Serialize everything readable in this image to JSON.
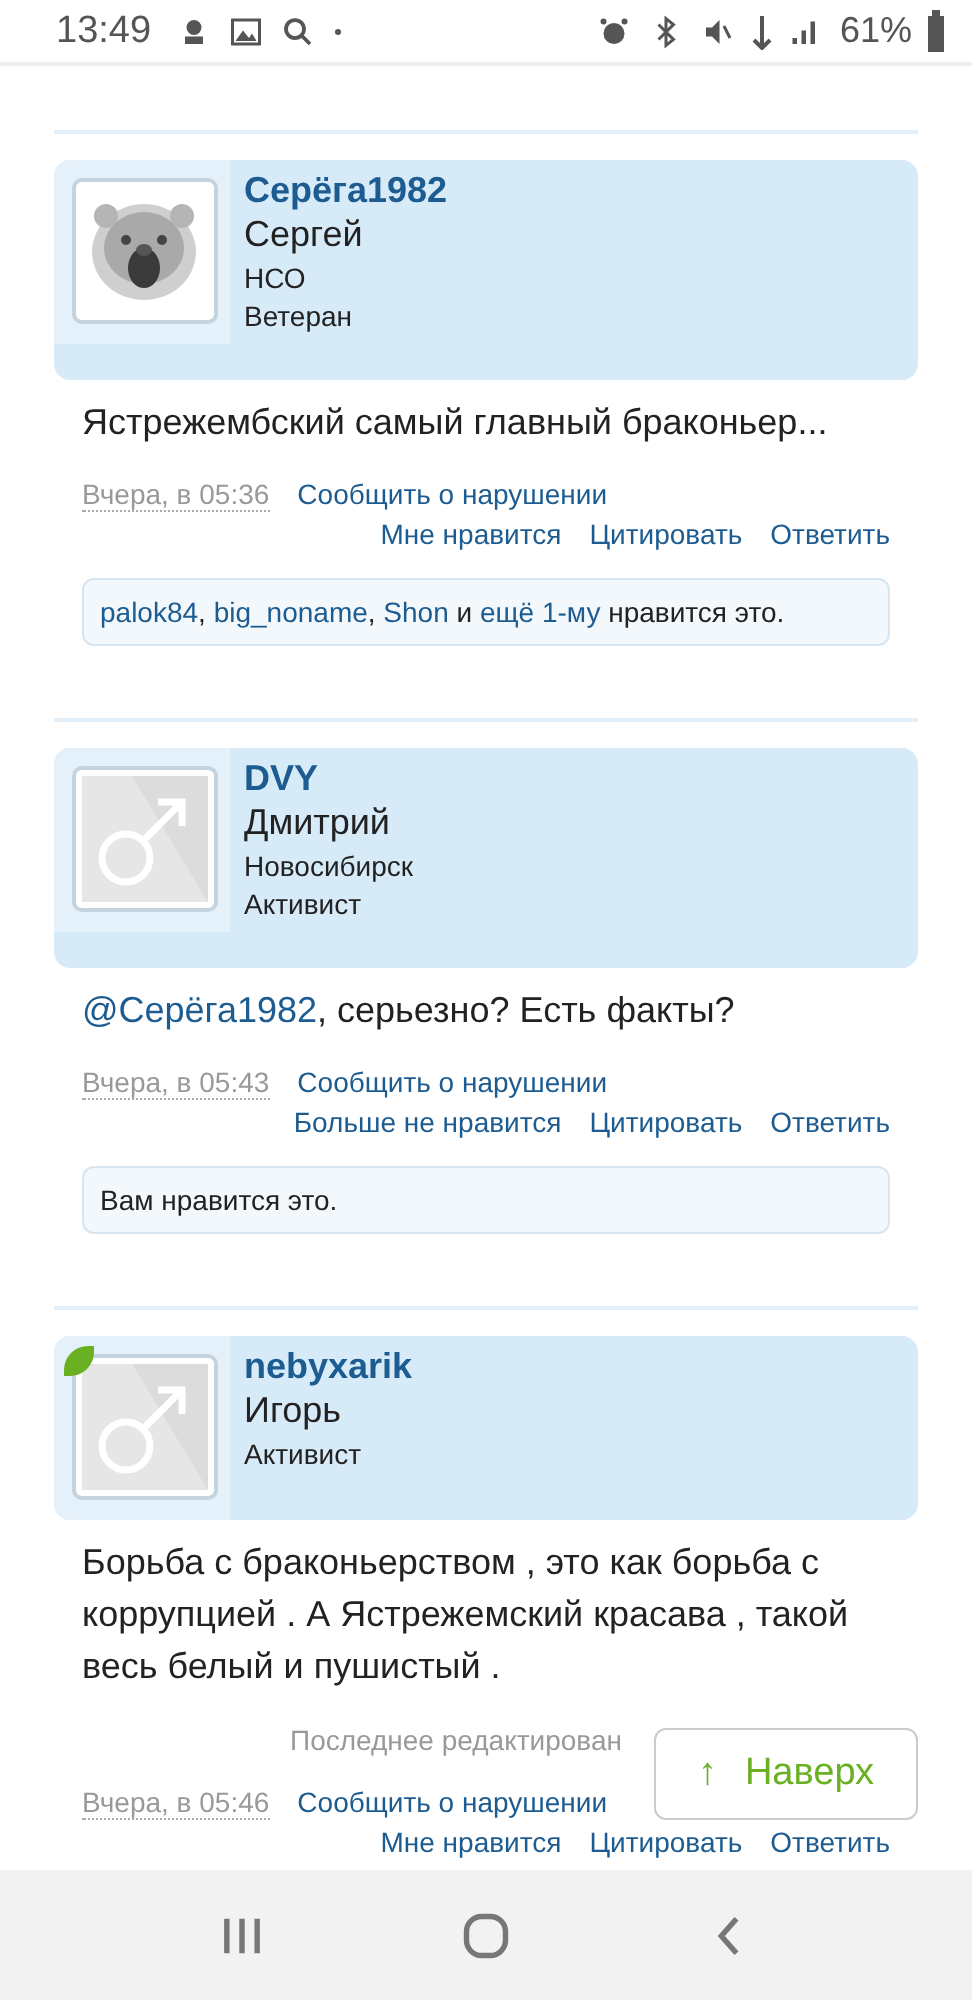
{
  "status_bar": {
    "time": "13:49",
    "battery": "61%"
  },
  "posts": [
    {
      "user": {
        "name": "Серёга1982",
        "real_name": "Сергей",
        "location": "НСО",
        "rank": "Ветеран",
        "online": false
      },
      "message": [
        {
          "kind": "plain",
          "text": "Ястрежембский самый главный браконьер..."
        }
      ],
      "date": "Вчера, в 05:36",
      "report": "Сообщить о нарушении",
      "actions": [
        "Мне нравится",
        "Цитировать",
        "Ответить"
      ],
      "likes": [
        {
          "kind": "link",
          "text": "palok84"
        },
        {
          "kind": "plain",
          "text": ", "
        },
        {
          "kind": "link",
          "text": "big_noname"
        },
        {
          "kind": "plain",
          "text": ", "
        },
        {
          "kind": "link",
          "text": "Shon"
        },
        {
          "kind": "plain",
          "text": " и "
        },
        {
          "kind": "link",
          "text": "ещё 1-му"
        },
        {
          "kind": "plain",
          "text": " нравится это."
        }
      ]
    },
    {
      "user": {
        "name": "DVY",
        "real_name": "Дмитрий",
        "location": "Новосибирск",
        "rank": "Активист",
        "avatar": {
          "kind": "male"
        },
        "online": false
      },
      "message": [
        {
          "kind": "link",
          "text": "@Серёга1982"
        },
        {
          "kind": "plain",
          "text": ", серьезно? Есть факты?"
        }
      ],
      "date": "Вчера, в 05:43",
      "report": "Сообщить о нарушении",
      "actions": [
        "Больше не нравится",
        "Цитировать",
        "Ответить"
      ],
      "likes": [
        {
          "kind": "plain",
          "text": "Вам нравится это."
        }
      ]
    },
    {
      "user": {
        "name": "nebyxarik",
        "real_name": "Игорь",
        "rank": "Активист",
        "avatar": {
          "kind": "male"
        },
        "online": true
      },
      "message": [
        {
          "kind": "plain",
          "text": "Борьба с браконьерством , это как борьба с коррупцией . А Ястрежемский красава , такой весь белый и пушистый ."
        }
      ],
      "edited": "Последнее редактирован",
      "date": "Вчера, в 05:46",
      "report": "Сообщить о нарушении",
      "actions": [
        "Мне нравится",
        "Цитировать",
        "Ответить"
      ]
    }
  ],
  "scroll_top_button": {
    "label": "Наверх",
    "icon": "↑"
  }
}
